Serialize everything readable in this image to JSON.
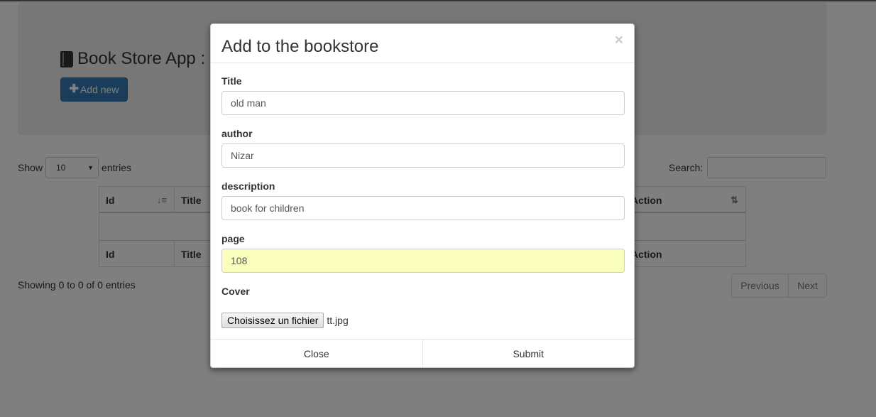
{
  "app": {
    "title": "Book Store App :",
    "add_new_label": "Add new"
  },
  "table_controls": {
    "show_label": "Show",
    "length_value": "10",
    "entries_label": "entries",
    "search_label": "Search:",
    "search_value": ""
  },
  "table": {
    "header": [
      "Id",
      "Title",
      "Action"
    ],
    "footer": [
      "Id",
      "Title",
      "Action"
    ],
    "rows": []
  },
  "table_info": "Showing 0 to 0 of 0 entries",
  "pagination": {
    "previous_label": "Previous",
    "next_label": "Next"
  },
  "modal": {
    "title": "Add to the bookstore",
    "close_symbol": "×",
    "fields": {
      "title": {
        "label": "Title",
        "value": "old man"
      },
      "author": {
        "label": "author",
        "value": "Nizar"
      },
      "description": {
        "label": "description",
        "value": "book for children"
      },
      "page": {
        "label": "page",
        "value": "108"
      },
      "cover": {
        "label": "Cover",
        "button_label": "Choisissez un fichier",
        "file_name": "tt.jpg"
      }
    },
    "footer": {
      "close_label": "Close",
      "submit_label": "Submit"
    }
  },
  "icons": {
    "book": "book-icon",
    "plus": "plus-icon",
    "sort_asc": "sort-ascending-icon",
    "sort_both": "sort-icon",
    "caret": "caret-down-icon",
    "close": "close-icon"
  },
  "colors": {
    "primary": "#337ab7",
    "autofill": "#faffbd",
    "backdrop": "rgba(0,0,0,0.5)"
  }
}
